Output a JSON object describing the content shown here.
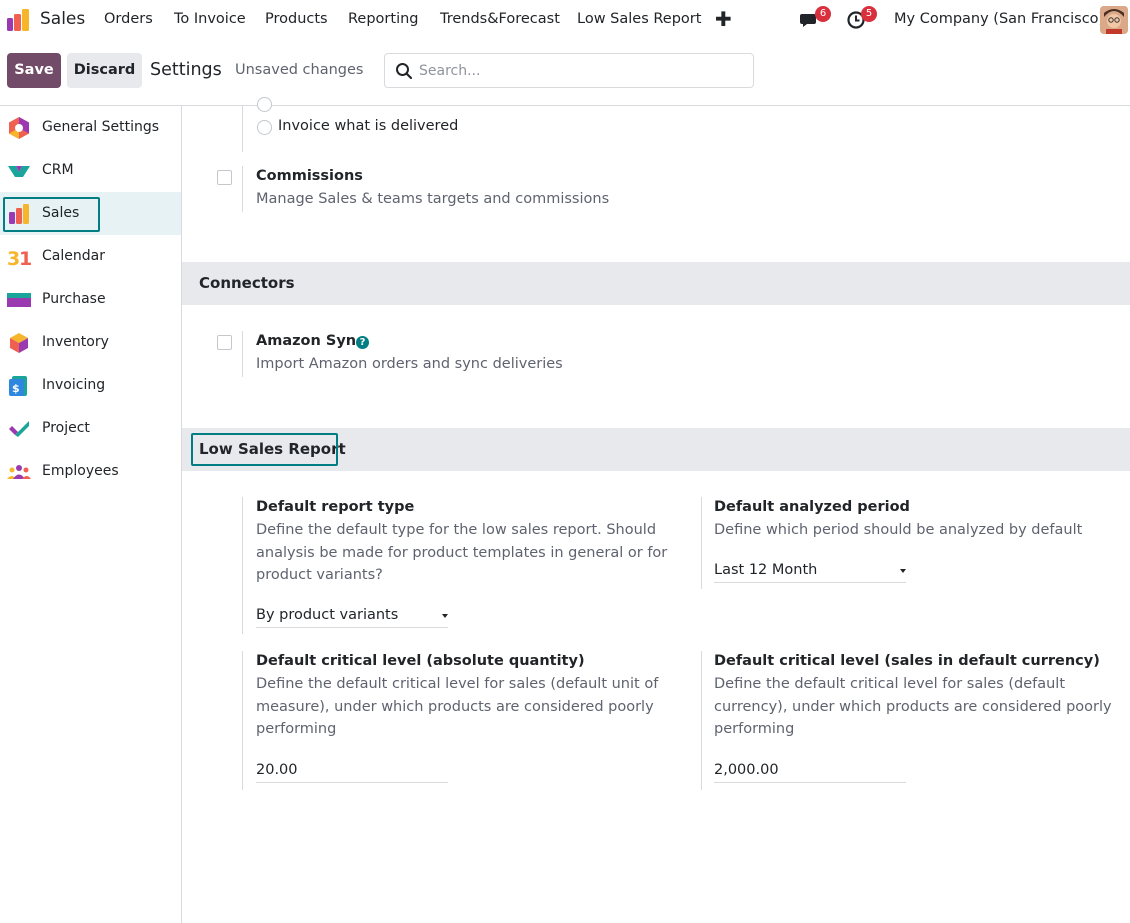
{
  "topbar": {
    "app_name": "Sales",
    "menu": [
      "Orders",
      "To Invoice",
      "Products",
      "Reporting",
      "Trends&Forecast",
      "Low Sales Report"
    ],
    "add_icon": "plus-icon",
    "messages_count": "6",
    "activities_count": "5",
    "company": "My Company (San Francisco)"
  },
  "control_panel": {
    "save_label": "Save",
    "discard_label": "Discard",
    "title": "Settings",
    "status": "Unsaved changes",
    "search_placeholder": "Search..."
  },
  "sidebar": {
    "items": [
      {
        "label": "General Settings",
        "icon": "general-settings-icon"
      },
      {
        "label": "CRM",
        "icon": "crm-icon"
      },
      {
        "label": "Sales",
        "icon": "sales-icon",
        "active": true
      },
      {
        "label": "Calendar",
        "icon": "calendar-icon"
      },
      {
        "label": "Purchase",
        "icon": "purchase-icon"
      },
      {
        "label": "Inventory",
        "icon": "inventory-icon"
      },
      {
        "label": "Invoicing",
        "icon": "invoicing-icon"
      },
      {
        "label": "Project",
        "icon": "project-icon"
      },
      {
        "label": "Employees",
        "icon": "employees-icon"
      }
    ]
  },
  "content": {
    "invoice_option": "Invoice what is delivered",
    "commissions": {
      "title": "Commissions",
      "description": "Manage Sales & teams targets and commissions"
    },
    "connectors": {
      "heading": "Connectors",
      "amazon": {
        "title": "Amazon Sync",
        "description": "Import Amazon orders and sync deliveries"
      }
    },
    "low_sales_report": {
      "heading": "Low Sales Report",
      "report_type": {
        "title": "Default report type",
        "desc_lines": [
          "Define the default type for the low sales report. Should",
          "analysis be made for product templates in general or for",
          "product variants?"
        ],
        "value": "By product variants"
      },
      "analyzed_period": {
        "title": "Default analyzed period",
        "desc_lines": [
          "Define which period should be analyzed by default"
        ],
        "value": "Last 12 Month"
      },
      "critical_qty": {
        "title": "Default critical level (absolute quantity)",
        "desc_lines": [
          "Define the default critical level for sales (default unit of",
          "measure), under which products are considered poorly",
          "performing"
        ],
        "value": "20.00"
      },
      "critical_currency": {
        "title": "Default critical level (sales in default currency)",
        "desc_lines": [
          "Define the default critical level for sales (default",
          "currency), under which products are considered poorly",
          "performing"
        ],
        "value": "2,000.00"
      }
    }
  },
  "colors": {
    "brand": "#714b67",
    "accent": "#017e84",
    "badge": "#d9303e"
  }
}
